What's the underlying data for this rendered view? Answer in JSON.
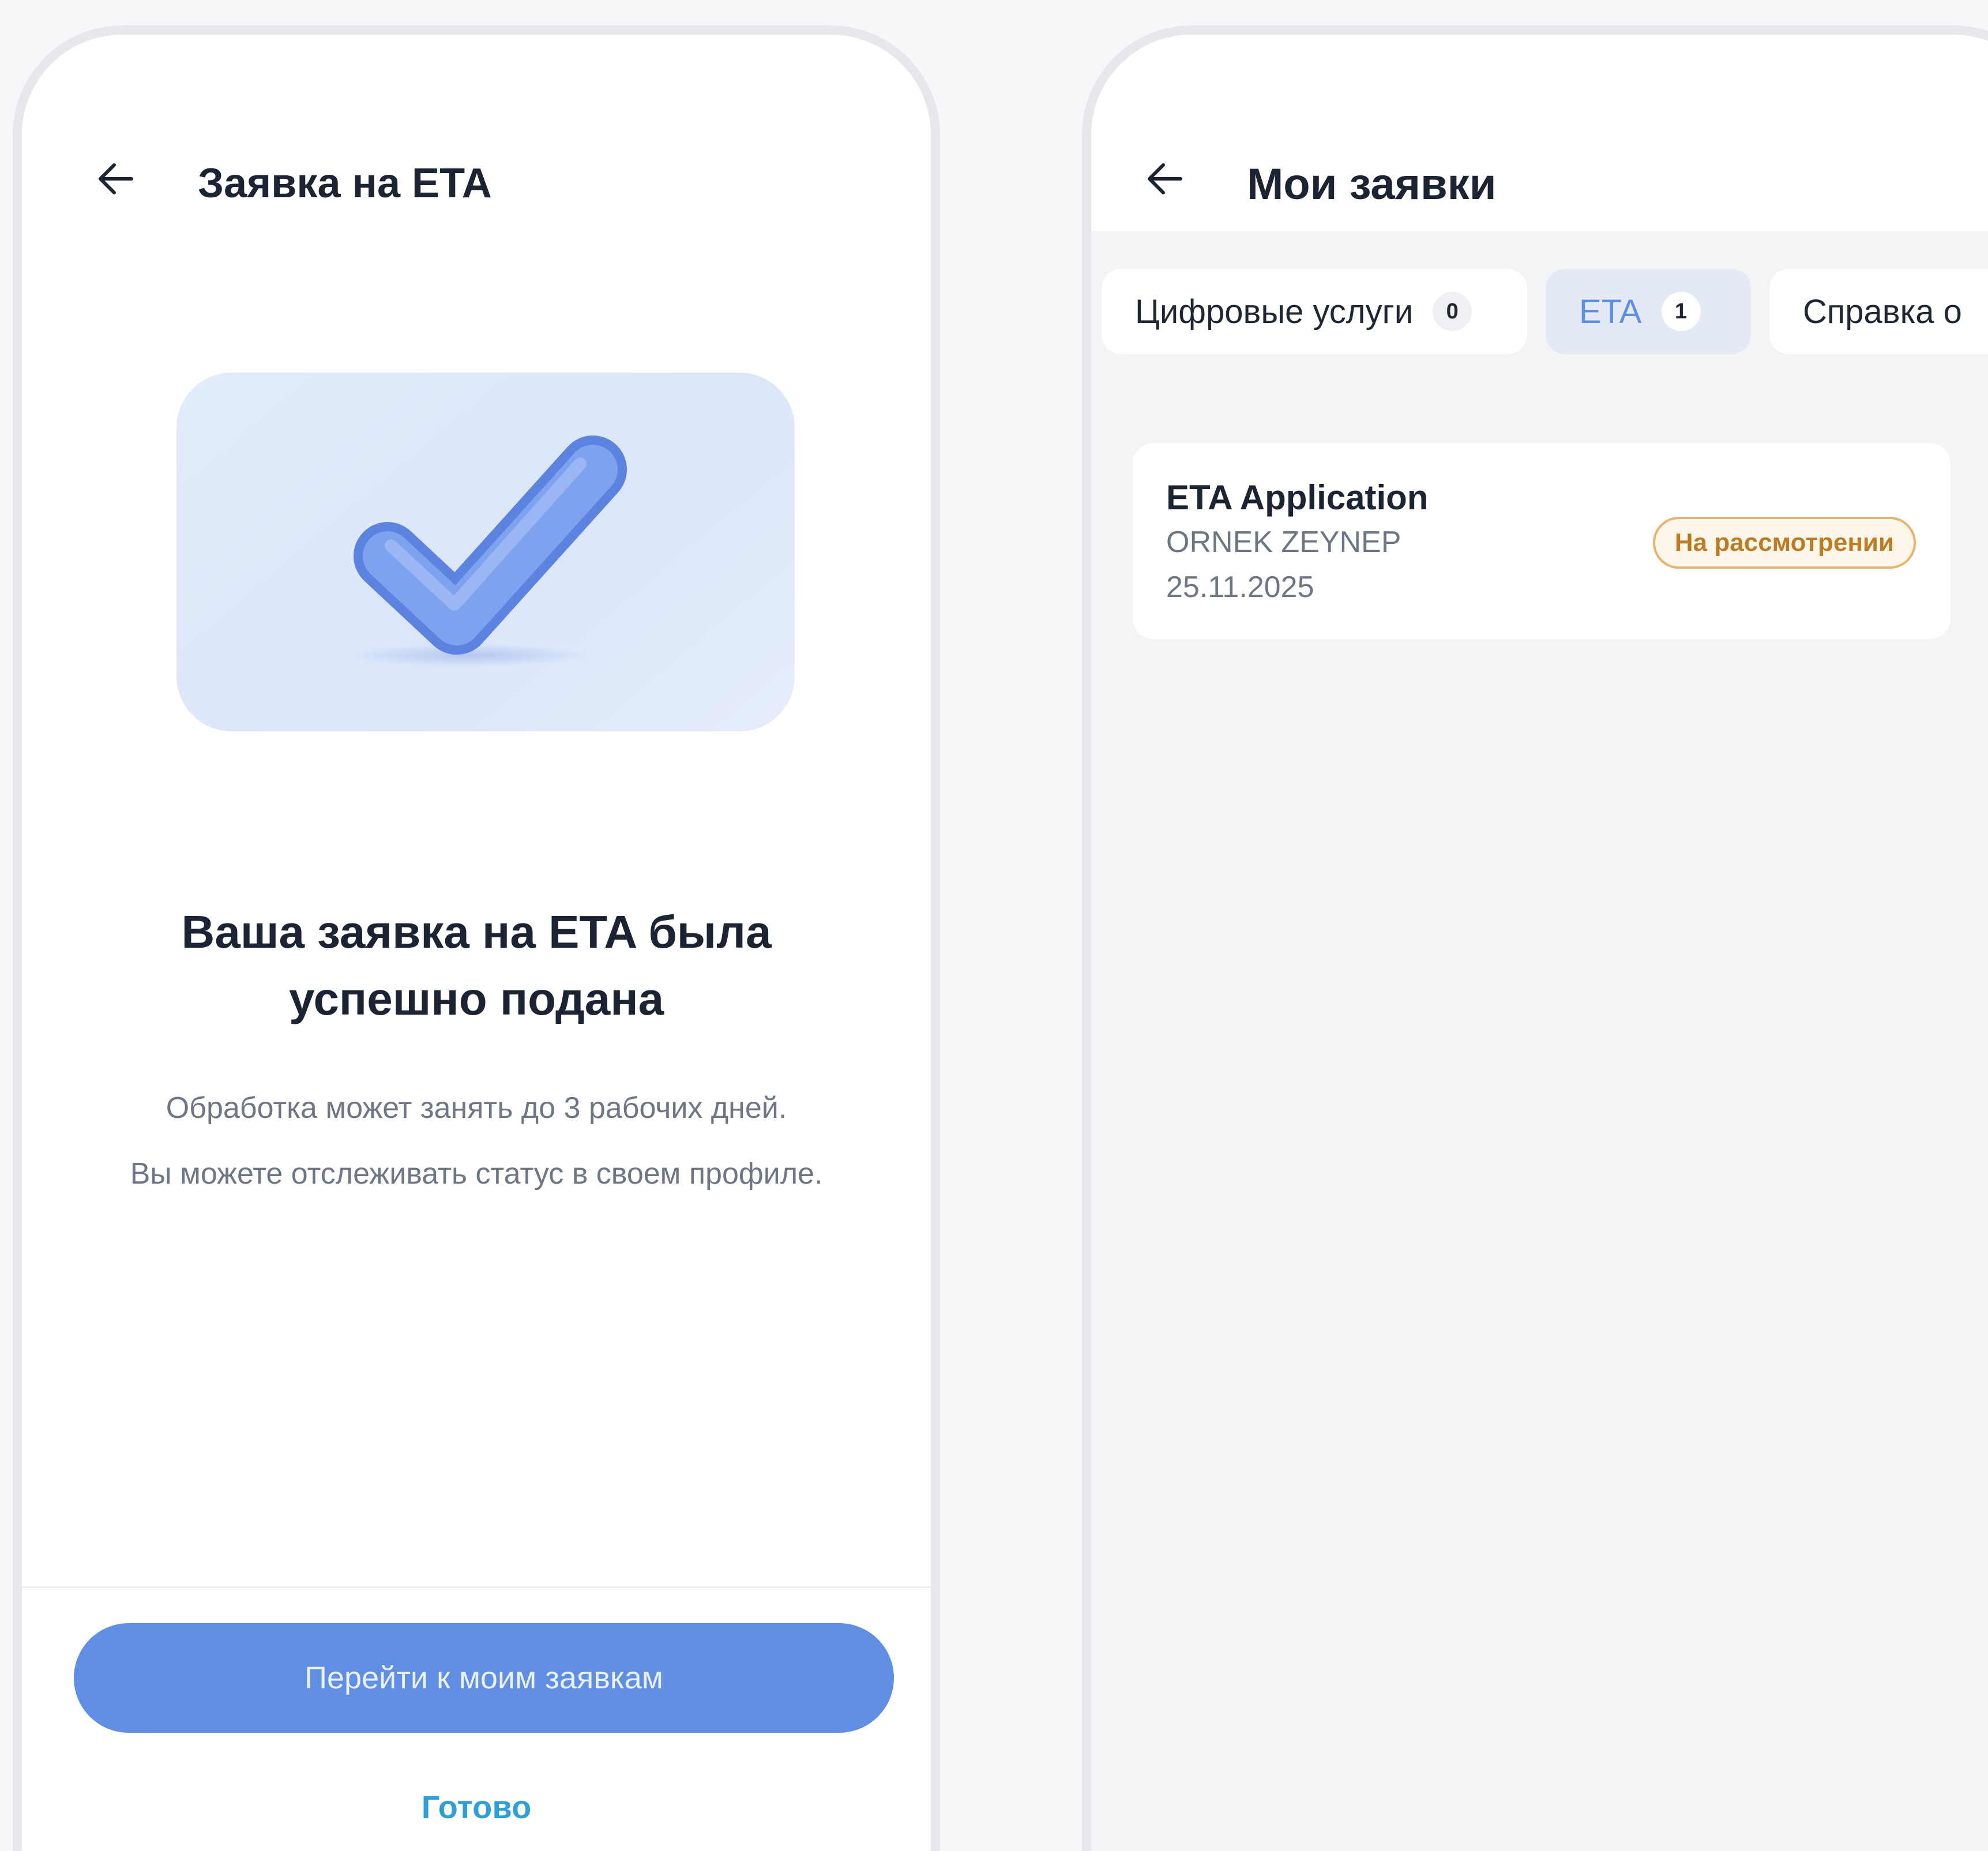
{
  "left_screen": {
    "header": {
      "title": "Заявка на ETA"
    },
    "success": {
      "title": "Ваша заявка на ETA была успешно подана",
      "description_line1": "Обработка может занять до 3 рабочих дней.",
      "description_line2": "Вы можете отслеживать статус в своем профиле."
    },
    "actions": {
      "primary_label": "Перейти к моим заявкам",
      "secondary_label": "Готово"
    },
    "icons": {
      "back": "arrow-left-icon",
      "hero": "checkmark-icon"
    }
  },
  "right_screen": {
    "header": {
      "title": "Мои заявки"
    },
    "tabs": [
      {
        "label": "Цифровые услуги",
        "count": "0",
        "active": false
      },
      {
        "label": "ETA",
        "count": "1",
        "active": true
      },
      {
        "label": "Справка о",
        "active": false
      }
    ],
    "applications": [
      {
        "title": "ETA Application",
        "name": "ORNEK ZEYNEP",
        "date": "25.11.2025",
        "status": "На рассмотрении"
      }
    ],
    "icons": {
      "back": "arrow-left-icon"
    }
  },
  "colors": {
    "primary": "#5f8ee3",
    "link": "#2f9fd8",
    "status_pending": "#bd7b24",
    "status_pending_border": "#e8b46d",
    "text_dark": "#1c2434",
    "text_muted": "#6e7685"
  }
}
